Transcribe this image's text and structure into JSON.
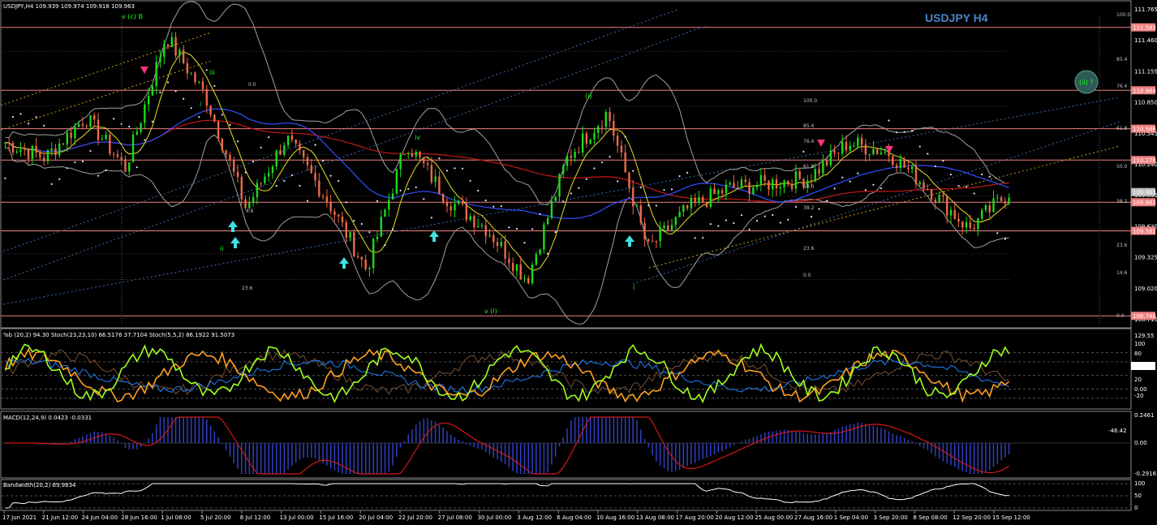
{
  "header": {
    "instrument_line": "USDJPY,H4  109.939 109.974 109.918 109.963",
    "chart_title": "USDJPY H4"
  },
  "panels": {
    "stoch_header": "%b (20,2) 94.30  Stoch(23,23,10) 66.5176 37.7104  Stoch(5,5,2) 86.1922 91.5073",
    "macd_header": "MACD(12,24,9) 0.0423 -0.0331",
    "bw_header": "Bandwidth(20,2) 69.9834"
  },
  "price_axis": {
    "ticks": [
      "111.765",
      "111.460",
      "111.155",
      "110.850",
      "110.545",
      "110.240",
      "109.935",
      "109.630",
      "109.325",
      "109.020",
      "108.715"
    ],
    "tick_values": [
      111.765,
      111.46,
      111.155,
      110.85,
      110.545,
      110.24,
      109.935,
      109.63,
      109.325,
      109.02,
      108.715
    ],
    "boxes": [
      {
        "label": "111.583",
        "value": 111.583,
        "color": "#f08080"
      },
      {
        "label": "110.964",
        "value": 110.964,
        "color": "#f08080"
      },
      {
        "label": "110.586",
        "value": 110.586,
        "color": "#f08080"
      },
      {
        "label": "110.278",
        "value": 110.278,
        "color": "#f08080"
      },
      {
        "label": "109.963",
        "value": 109.963,
        "color": "#c0c0c0"
      },
      {
        "label": "109.863",
        "value": 109.863,
        "color": "#f08080"
      },
      {
        "label": "109.582",
        "value": 109.582,
        "color": "#f08080"
      },
      {
        "label": "108.746",
        "value": 108.746,
        "color": "#f08080"
      }
    ],
    "range": [
      108.66,
      111.82
    ]
  },
  "stoch_axis": {
    "ticks": [
      "129.55",
      "100",
      "80",
      "50",
      "20",
      "0.00",
      "-20"
    ],
    "value_box": "50.50"
  },
  "macd_axis": {
    "ticks": [
      "0.2461",
      "0.00",
      "-0.2916"
    ],
    "neg_label": "-46.42"
  },
  "bw_axis": {
    "ticks": [
      "100",
      "50",
      "0"
    ]
  },
  "time_axis": [
    "17 Jun 2021",
    "21 Jun 12:00",
    "24 Jun 04:00",
    "28 Jun 16:00",
    "1 Jul 08:00",
    "5 Jul 20:00",
    "8 Jul 12:00",
    "13 Jul 00:00",
    "15 Jul 16:00",
    "20 Jul 04:00",
    "22 Jul 20:00",
    "27 Jul 08:00",
    "30 Jul 00:00",
    "3 Aug 12:00",
    "6 Aug 04:00",
    "10 Aug 16:00",
    "13 Aug 08:00",
    "17 Aug 20:00",
    "20 Aug 12:00",
    "25 Aug 00:00",
    "27 Aug 16:00",
    "1 Sep 04:00",
    "3 Sep 20:00",
    "8 Sep 08:00",
    "12 Sep 20:00",
    "15 Sep 12:00"
  ],
  "wave_labels": [
    "v (c) B",
    "i",
    "ii",
    "iii",
    "iv",
    "v (i)",
    "(i)",
    "i",
    "(ii) ?"
  ],
  "fibo_left": [
    "0.0",
    "23.6",
    "4.6"
  ],
  "fibo_right": [
    "100.0",
    "85.4",
    "76.4",
    "61.8",
    "50.0",
    "38.2",
    "23.6",
    "14.6",
    "0.0"
  ],
  "fibo_mid": [
    "100.0",
    "85.4",
    "76.4",
    "61.8",
    "50.0",
    "38.2",
    "23.6",
    "0.0"
  ],
  "colors": {
    "bull": "#1adc1a",
    "bear": "#ef6a4a",
    "hline": "#f08080",
    "ma_red": "#c01818",
    "ma_blue": "#3050ff",
    "ma_yellow": "#e8e020",
    "band": "#a0a0a0",
    "psar": "#e8e0ff",
    "arrow_up": "#40e0e0",
    "arrow_down": "#ff3080",
    "stoch_green": "#a0ff20",
    "stoch_orange": "#ffa020",
    "stoch_blue": "#2080ff",
    "macd_hist": "#3040c0",
    "macd_sig": "#d01818"
  },
  "chart_data": {
    "type": "line",
    "title": "USDJPY H4",
    "x": [
      "17 Jun 2021",
      "21 Jun 12:00",
      "24 Jun 04:00",
      "28 Jun 16:00",
      "1 Jul 08:00",
      "5 Jul 20:00",
      "8 Jul 12:00",
      "13 Jul 00:00",
      "15 Jul 16:00",
      "20 Jul 04:00",
      "22 Jul 20:00",
      "27 Jul 08:00",
      "30 Jul 00:00",
      "3 Aug 12:00",
      "6 Aug 04:00",
      "10 Aug 16:00",
      "13 Aug 08:00",
      "17 Aug 20:00",
      "20 Aug 12:00",
      "25 Aug 00:00",
      "27 Aug 16:00",
      "1 Sep 04:00",
      "3 Sep 20:00",
      "8 Sep 08:00",
      "12 Sep 20:00",
      "15 Sep 12:00"
    ],
    "series": [
      {
        "values": [
          110.45,
          110.3,
          110.7,
          110.2,
          111.5,
          110.9,
          109.8,
          110.5,
          109.9,
          109.2,
          110.45,
          109.9,
          109.6,
          109.1,
          110.3,
          110.75,
          109.4,
          109.8,
          110.0,
          110.05,
          110.1,
          110.45,
          110.35,
          110.0,
          109.6,
          109.96
        ]
      }
    ],
    "ylim": [
      108.66,
      111.82
    ],
    "last_ohlc": {
      "open": 109.939,
      "high": 109.974,
      "low": 109.918,
      "close": 109.963
    }
  }
}
